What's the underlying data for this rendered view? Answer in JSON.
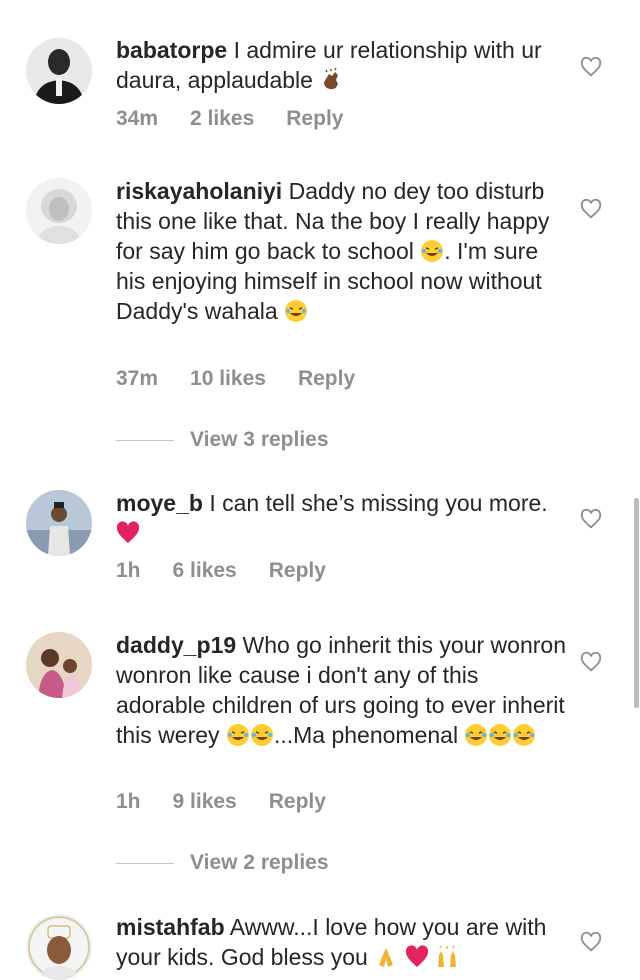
{
  "comments": [
    {
      "username": "babatorpe",
      "text": " I admire ur relationship with ur daura, applaudable",
      "emoji": "clapping-hands-emoji",
      "time": "34m",
      "likes": "2 likes",
      "reply": "Reply"
    },
    {
      "username": "riskayaholaniyi",
      "text_a": " Daddy no dey too disturb this one like that. Na the boy I really happy for say him go back to school",
      "text_b": ". I'm sure his enjoying himself in school now without Daddy's wahala",
      "time": "37m",
      "likes": "10 likes",
      "reply": "Reply",
      "view_replies": "View 3 replies"
    },
    {
      "username": "moye_b",
      "text": " I can tell she’s missing you more.",
      "time": "1h",
      "likes": "6 likes",
      "reply": "Reply"
    },
    {
      "username": "daddy_p19",
      "text_a": " Who go inherit this your wonron wonron like cause i don't any of this adorable children of urs going to ever inherit this werey",
      "text_b": "...Ma phenomenal",
      "time": "1h",
      "likes": "9 likes",
      "reply": "Reply",
      "view_replies": "View 2 replies"
    },
    {
      "username": "mistahfab",
      "text": " Awww...I love how you are with your kids. God bless you",
      "time": "",
      "likes": "",
      "reply": ""
    }
  ],
  "colors": {
    "text": "#262626",
    "muted": "#8e8e8e",
    "heart_red": "#e0245e",
    "emoji_yellow": "#ffcc33"
  }
}
